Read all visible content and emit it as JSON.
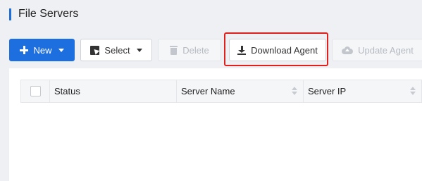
{
  "page": {
    "title": "File Servers",
    "accent_color": "#1e6fd9"
  },
  "toolbar": {
    "new_label": "New",
    "select_label": "Select",
    "delete_label": "Delete",
    "download_agent_label": "Download Agent",
    "update_agent_label": "Update Agent",
    "primary_color": "#1d6fe0",
    "highlight_color": "#e0201d"
  },
  "table": {
    "columns": [
      "Status",
      "Server Name",
      "Server IP"
    ]
  },
  "icons": {
    "new": "plus-icon",
    "select": "select-cursor-icon",
    "delete": "trash-icon",
    "download": "download-icon",
    "update": "cloud-upload-icon",
    "dropdown": "caret-down-icon",
    "sort": "sort-icon"
  }
}
